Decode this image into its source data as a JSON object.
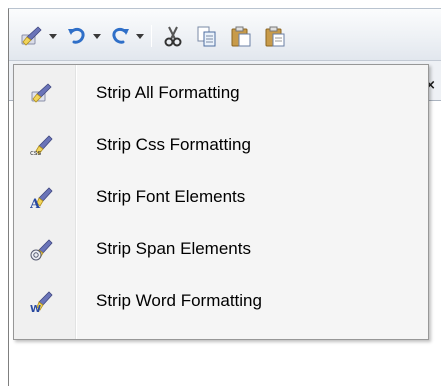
{
  "toolbar": {
    "buttons": [
      {
        "icon": "strip-formatting-icon",
        "has_dropdown": true
      },
      {
        "icon": "undo-icon",
        "has_dropdown": true
      },
      {
        "icon": "redo-icon",
        "has_dropdown": true
      },
      {
        "icon": "cut-icon",
        "has_dropdown": false
      },
      {
        "icon": "copy-icon",
        "has_dropdown": false
      },
      {
        "icon": "paste-icon",
        "has_dropdown": false
      },
      {
        "icon": "paste-plain-icon",
        "has_dropdown": false
      }
    ]
  },
  "tab": {
    "close_glyph": "×"
  },
  "menu": {
    "items": [
      {
        "label": "Strip All Formatting",
        "icon": "strip-all-formatting-icon"
      },
      {
        "label": "Strip Css Formatting",
        "icon": "strip-css-formatting-icon",
        "icon_text": "css"
      },
      {
        "label": "Strip Font Elements",
        "icon": "strip-font-elements-icon",
        "icon_text": "A"
      },
      {
        "label": "Strip Span Elements",
        "icon": "strip-span-elements-icon"
      },
      {
        "label": "Strip Word Formatting",
        "icon": "strip-word-formatting-icon",
        "icon_text": "W"
      }
    ]
  },
  "colors": {
    "menu_background": "#f5f5f5",
    "menu_border": "#979797",
    "brush_handle": "#6a74b8",
    "brush_bristles": "#f2d55a",
    "undo_arrow": "#2f6fc8",
    "redo_arrow": "#2f6fc8"
  }
}
